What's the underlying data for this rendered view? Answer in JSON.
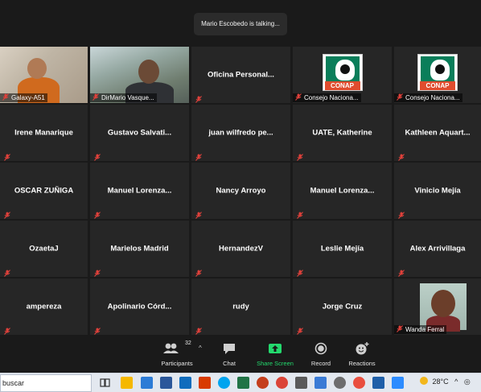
{
  "speaker_banner": "Mario Escobedo is talking...",
  "tiles": [
    {
      "id": "galaxy-a51",
      "caption": "Galaxy-A51"
    },
    {
      "id": "dirmario",
      "caption": "DirMario Vasque..."
    },
    {
      "id": "oficina",
      "name": "Oficina  Personal..."
    },
    {
      "id": "consejo-1",
      "caption": "Consejo Naciona..."
    },
    {
      "id": "consejo-2",
      "caption": "Consejo Naciona..."
    },
    {
      "id": "irene",
      "name": "Irene Manarique"
    },
    {
      "id": "gustavo",
      "name": "Gustavo  Salvati..."
    },
    {
      "id": "juan",
      "name": "juan  wilfredo  pe..."
    },
    {
      "id": "uate",
      "name": "UATE, Katherine"
    },
    {
      "id": "kathleen",
      "name": "Kathleen  Aquart..."
    },
    {
      "id": "oscar",
      "name": "OSCAR ZUÑIGA"
    },
    {
      "id": "manuel-1",
      "name": "Manuel  Lorenza..."
    },
    {
      "id": "nancy",
      "name": "Nancy Arroyo"
    },
    {
      "id": "manuel-2",
      "name": "Manuel  Lorenza..."
    },
    {
      "id": "vinicio",
      "name": "Vinicio Mejía"
    },
    {
      "id": "ozaeta",
      "name": "OzaetaJ"
    },
    {
      "id": "marielos",
      "name": "Marielos Madrid"
    },
    {
      "id": "hernandez",
      "name": "HernandezV"
    },
    {
      "id": "leslie",
      "name": "Leslie Mejía"
    },
    {
      "id": "alex",
      "name": "Alex Arrivillaga"
    },
    {
      "id": "ampereza",
      "name": "ampereza"
    },
    {
      "id": "apolinario",
      "name": "Apolinario  Córd..."
    },
    {
      "id": "rudy",
      "name": "rudy"
    },
    {
      "id": "jorge",
      "name": "Jorge Cruz"
    },
    {
      "id": "wanda",
      "caption": "Wanda Ferral"
    }
  ],
  "logo_text": "CONAP",
  "toolbar": {
    "participants_label": "Participants",
    "participants_count": "32",
    "chat_label": "Chat",
    "share_label": "Share Screen",
    "record_label": "Record",
    "reactions_label": "Reactions"
  },
  "taskbar": {
    "search_text": "buscar",
    "temperature": "28°C"
  },
  "colors": {
    "share_green": "#23d96d",
    "muted_red": "#e0413b",
    "conap_green": "#0a7e5a"
  }
}
